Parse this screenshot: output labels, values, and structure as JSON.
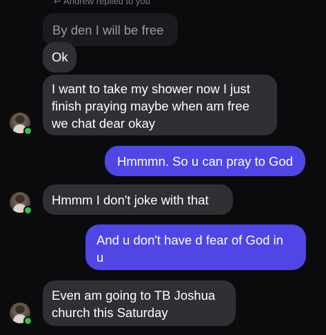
{
  "reply_header": {
    "icon": "reply-arrow-icon",
    "text": "Andrew replied to you"
  },
  "messages": {
    "quoted": "By den I will be free",
    "ok": "Ok",
    "shower": [
      "I want to take my shower now I just",
      "finish praying maybe when am free",
      "we chat dear okay"
    ],
    "hmmmn": "Hmmmn. So u can pray to God",
    "joke": "Hmmm I don't joke with that",
    "fear": [
      "And u don't have d fear of God in",
      "u"
    ],
    "church": [
      "Even am going to TB Joshua",
      "church this Saturday"
    ]
  },
  "colors": {
    "background": "#0b0b0d",
    "incoming_bubble": "#2f3034",
    "outgoing_bubble": "#4f46e5",
    "online_dot": "#31c24a"
  }
}
